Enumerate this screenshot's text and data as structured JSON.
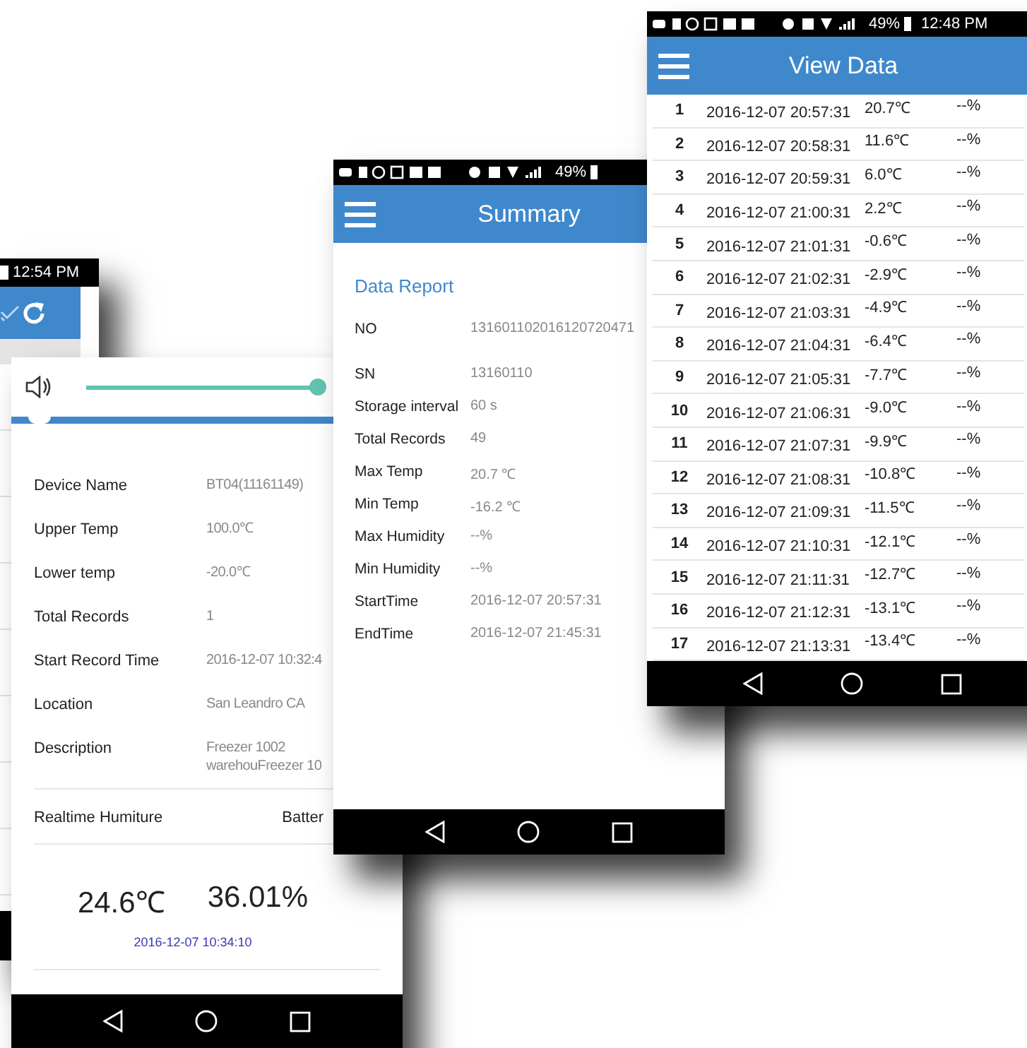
{
  "back_phone": {
    "time": "12:54 PM"
  },
  "device_phone": {
    "volume": {
      "level": 1
    },
    "fields": [
      {
        "label": "Device Name",
        "values": [
          "BT04(11161149)"
        ]
      },
      {
        "label": "Upper Temp",
        "values": [
          "100.0℃"
        ]
      },
      {
        "label": "Lower temp",
        "values": [
          "-20.0℃"
        ]
      },
      {
        "label": "Total Records",
        "values": [
          "1"
        ]
      },
      {
        "label": "Start Record Time",
        "values": [
          "2016-12-07 10:32:4"
        ]
      },
      {
        "label": "Location",
        "values": [
          "San Leandro CA"
        ]
      },
      {
        "label": "Description",
        "values": [
          "Freezer 1002",
          "warehouFreezer 10"
        ]
      }
    ],
    "realtime": {
      "label": "Realtime Humiture",
      "battery_label": "Batter",
      "temperature": "24.6℃",
      "humidity": "36.01%",
      "time": "2016-12-07 10:34:10"
    }
  },
  "summary_phone": {
    "battery": "49%",
    "title": "Summary",
    "section": "Data Report",
    "fields": [
      {
        "label": "NO",
        "value": "131601102016120720471"
      },
      {
        "label": "SN",
        "value": "13160110"
      },
      {
        "label": "Storage interval",
        "value": "60 s"
      },
      {
        "label": "Total Records",
        "value": "49"
      },
      {
        "label": "Max Temp",
        "value": "20.7 ℃"
      },
      {
        "label": "Min Temp",
        "value": "-16.2 ℃"
      },
      {
        "label": "Max Humidity",
        "value": "--%"
      },
      {
        "label": "Min Humidity",
        "value": "--%"
      },
      {
        "label": "StartTime",
        "value": "2016-12-07 20:57:31"
      },
      {
        "label": "EndTime",
        "value": "2016-12-07 21:45:31"
      }
    ]
  },
  "data_phone": {
    "battery": "49%",
    "time": "12:48 PM",
    "title": "View Data",
    "rows": [
      {
        "no": "1",
        "time": "2016-12-07 20:57:31",
        "temp": "20.7℃",
        "humidity": "--%"
      },
      {
        "no": "2",
        "time": "2016-12-07 20:58:31",
        "temp": "11.6℃",
        "humidity": "--%"
      },
      {
        "no": "3",
        "time": "2016-12-07 20:59:31",
        "temp": "6.0℃",
        "humidity": "--%"
      },
      {
        "no": "4",
        "time": "2016-12-07 21:00:31",
        "temp": "2.2℃",
        "humidity": "--%"
      },
      {
        "no": "5",
        "time": "2016-12-07 21:01:31",
        "temp": "-0.6℃",
        "humidity": "--%"
      },
      {
        "no": "6",
        "time": "2016-12-07 21:02:31",
        "temp": "-2.9℃",
        "humidity": "--%"
      },
      {
        "no": "7",
        "time": "2016-12-07 21:03:31",
        "temp": "-4.9℃",
        "humidity": "--%"
      },
      {
        "no": "8",
        "time": "2016-12-07 21:04:31",
        "temp": "-6.4℃",
        "humidity": "--%"
      },
      {
        "no": "9",
        "time": "2016-12-07 21:05:31",
        "temp": "-7.7℃",
        "humidity": "--%"
      },
      {
        "no": "10",
        "time": "2016-12-07 21:06:31",
        "temp": "-9.0℃",
        "humidity": "--%"
      },
      {
        "no": "11",
        "time": "2016-12-07 21:07:31",
        "temp": "-9.9℃",
        "humidity": "--%"
      },
      {
        "no": "12",
        "time": "2016-12-07 21:08:31",
        "temp": "-10.8℃",
        "humidity": "--%"
      },
      {
        "no": "13",
        "time": "2016-12-07 21:09:31",
        "temp": "-11.5℃",
        "humidity": "--%"
      },
      {
        "no": "14",
        "time": "2016-12-07 21:10:31",
        "temp": "-12.1℃",
        "humidity": "--%"
      },
      {
        "no": "15",
        "time": "2016-12-07 21:11:31",
        "temp": "-12.7℃",
        "humidity": "--%"
      },
      {
        "no": "16",
        "time": "2016-12-07 21:12:31",
        "temp": "-13.1℃",
        "humidity": "--%"
      },
      {
        "no": "17",
        "time": "2016-12-07 21:13:31",
        "temp": "-13.4℃",
        "humidity": "--%"
      }
    ]
  }
}
